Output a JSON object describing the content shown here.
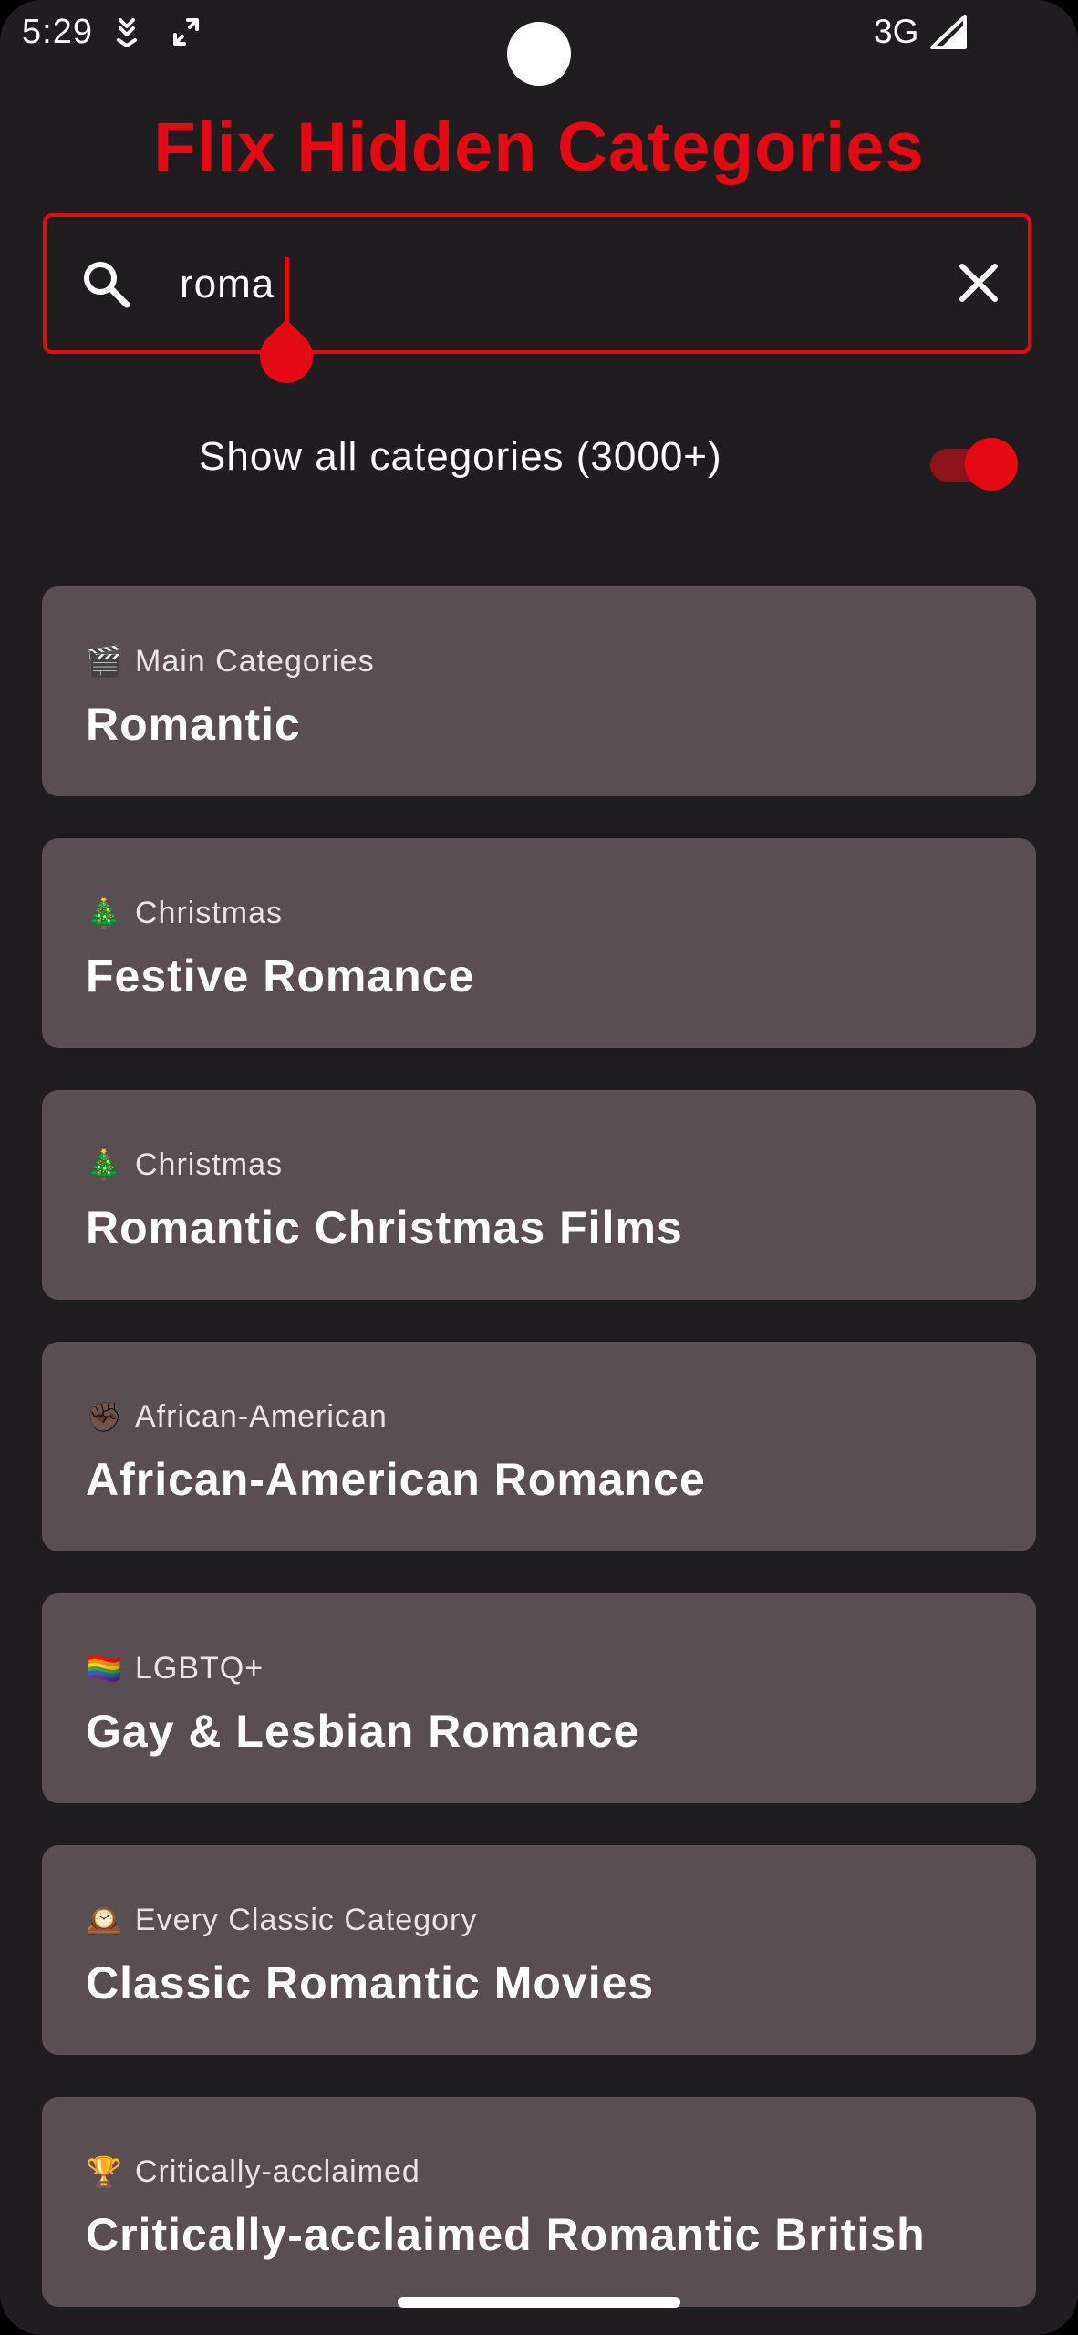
{
  "status_bar": {
    "time": "5:29",
    "network": "3G",
    "icons": [
      "download-status-icon",
      "rotate-icon",
      "signal-icon"
    ]
  },
  "app": {
    "title": "Flix Hidden Categories",
    "accent_color": "#e50914"
  },
  "search": {
    "value": "roma",
    "icon": "search-icon",
    "clear_icon": "close-icon"
  },
  "toggle": {
    "label": "Show all categories (3000+)",
    "enabled": true
  },
  "categories": [
    {
      "emoji": "🎬",
      "group": "Main Categories",
      "name": "Romantic"
    },
    {
      "emoji": "🎄",
      "group": "Christmas",
      "name": "Festive Romance"
    },
    {
      "emoji": "🎄",
      "group": "Christmas",
      "name": "Romantic Christmas Films"
    },
    {
      "emoji": "✊🏿",
      "group": "African-American",
      "name": "African-American Romance"
    },
    {
      "emoji": "🏳️‍🌈",
      "group": "LGBTQ+",
      "name": "Gay & Lesbian Romance"
    },
    {
      "emoji": "🕰️",
      "group": "Every Classic Category",
      "name": "Classic Romantic Movies"
    },
    {
      "emoji": "🏆",
      "group": "Critically-acclaimed",
      "name": "Critically-acclaimed Romantic British"
    }
  ]
}
